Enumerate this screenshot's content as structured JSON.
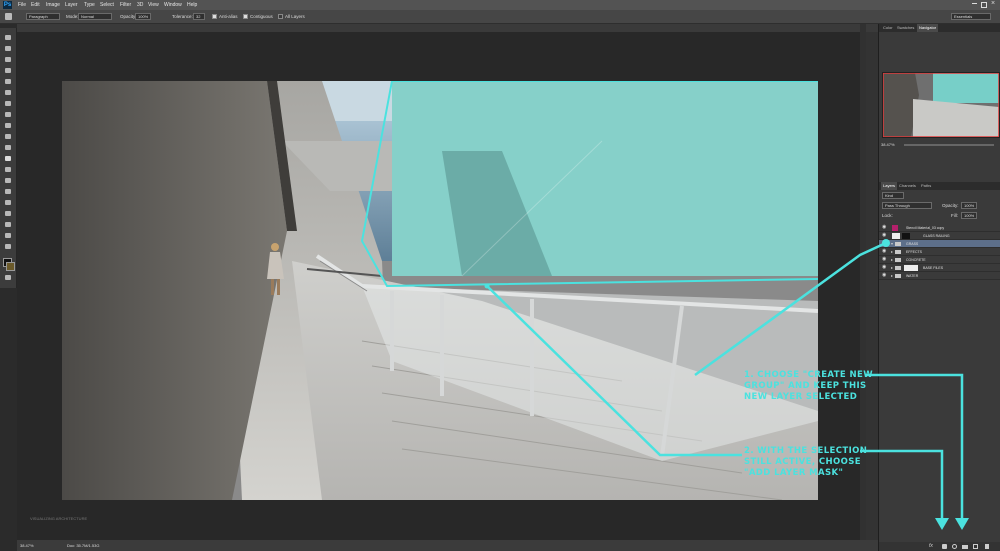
{
  "app": {
    "logo": "Ps"
  },
  "menus": [
    "File",
    "Edit",
    "Image",
    "Layer",
    "Type",
    "Select",
    "Filter",
    "3D",
    "View",
    "Window",
    "Help"
  ],
  "options": {
    "preset": "Paragraph",
    "mode_label": "Mode:",
    "mode_value": "Normal",
    "opacity_label": "Opacity:",
    "opacity_value": "100%",
    "tolerance_label": "Tolerance:",
    "tolerance_value": "32",
    "antialias": "Anti-alias",
    "contiguous": "Contiguous",
    "all_layers": "All Layers",
    "workspace": "Essentials"
  },
  "panels": {
    "top_tabs": [
      "Color",
      "Swatches",
      "Navigator"
    ],
    "zoom_value": "38.47%",
    "layer_tabs": [
      "Layers",
      "Channels",
      "Paths"
    ],
    "kind_label": "Kind",
    "blend_mode": "Pass Through",
    "opacity_label": "Opacity:",
    "opacity_value": "100%",
    "lock_label": "Lock:",
    "fill_label": "Fill:",
    "fill_value": "100%"
  },
  "layers": [
    {
      "name": "Stencil Material_03 copy",
      "selected": false,
      "group": false
    },
    {
      "name": "GLASS RAILING",
      "selected": false,
      "group": false
    },
    {
      "name": "GRASS",
      "selected": true,
      "group": true
    },
    {
      "name": "EFFECTS",
      "selected": false,
      "group": true
    },
    {
      "name": "CONCRETE",
      "selected": false,
      "group": true
    },
    {
      "name": "BASE FILES",
      "selected": false,
      "group": true
    },
    {
      "name": "WATER",
      "selected": false,
      "group": true
    }
  ],
  "status": {
    "zoom": "38.47%",
    "doc": "Doc: 35.7M/1.53G"
  },
  "callouts": {
    "step1": [
      "1. CHOOSE \"CREATE NEW",
      "GROUP\" AND KEEP THIS",
      "NEW LAYER SELECTED"
    ],
    "step2": [
      "2. WITH THE SELECTION",
      "STILL ACTIVE, CHOOSE",
      "\"ADD LAYER MASK\""
    ]
  },
  "watermark": "VISUALIZING ARCHITECTURE",
  "colors": {
    "selection": "#4be2df",
    "panel": "#3a3a3a",
    "canvas_bg": "#282828"
  }
}
